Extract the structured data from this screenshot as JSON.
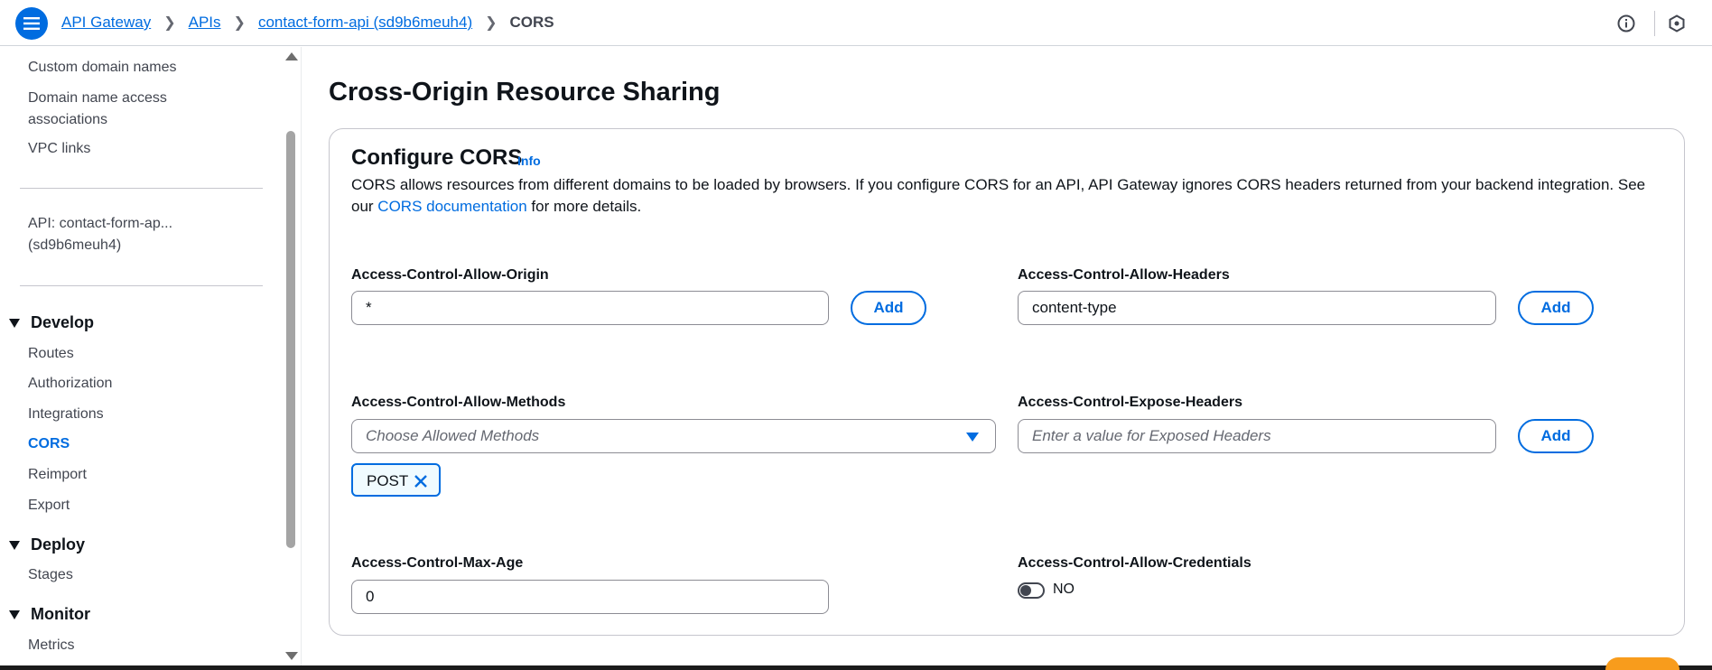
{
  "breadcrumb": {
    "items": [
      "API Gateway",
      "APIs",
      "contact-form-api (sd9b6meuh4)"
    ],
    "current": "CORS"
  },
  "top_icons": [
    "info-icon",
    "settings-hex-icon"
  ],
  "sidebar": {
    "items_top": [
      "Custom domain names",
      "Domain name access associations",
      "VPC links"
    ],
    "api_label": "API: contact-form-ap... (sd9b6meuh4)",
    "sections": [
      {
        "title": "Develop",
        "items": [
          "Routes",
          "Authorization",
          "Integrations",
          "CORS",
          "Reimport",
          "Export"
        ]
      },
      {
        "title": "Deploy",
        "items": [
          "Stages"
        ]
      },
      {
        "title": "Monitor",
        "items": [
          "Metrics"
        ]
      }
    ],
    "active_item": "CORS"
  },
  "main": {
    "page_title": "Cross-Origin Resource Sharing",
    "panel_title": "Configure CORS",
    "info_label": "Info",
    "desc_before": "CORS allows resources from different domains to be loaded by browsers. If you configure CORS for an API, API Gateway ignores CORS headers returned from your backend integration. See our ",
    "desc_link": "CORS documentation",
    "desc_after": " for more details.",
    "fields": {
      "allow_origin": {
        "label": "Access-Control-Allow-Origin",
        "value": "*",
        "button": "Add"
      },
      "allow_headers": {
        "label": "Access-Control-Allow-Headers",
        "value": "content-type",
        "button": "Add"
      },
      "allow_methods": {
        "label": "Access-Control-Allow-Methods",
        "placeholder": "Choose Allowed Methods",
        "tokens": [
          "POST"
        ]
      },
      "expose_headers": {
        "label": "Access-Control-Expose-Headers",
        "placeholder": "Enter a value for Exposed Headers",
        "button": "Add"
      },
      "max_age": {
        "label": "Access-Control-Max-Age",
        "value": "0"
      },
      "allow_credentials": {
        "label": "Access-Control-Allow-Credentials",
        "state": "NO"
      }
    }
  },
  "colors": {
    "accent": "#006ce0",
    "text": "#0f141a",
    "muted": "#424650",
    "border": "#8c8c94"
  }
}
